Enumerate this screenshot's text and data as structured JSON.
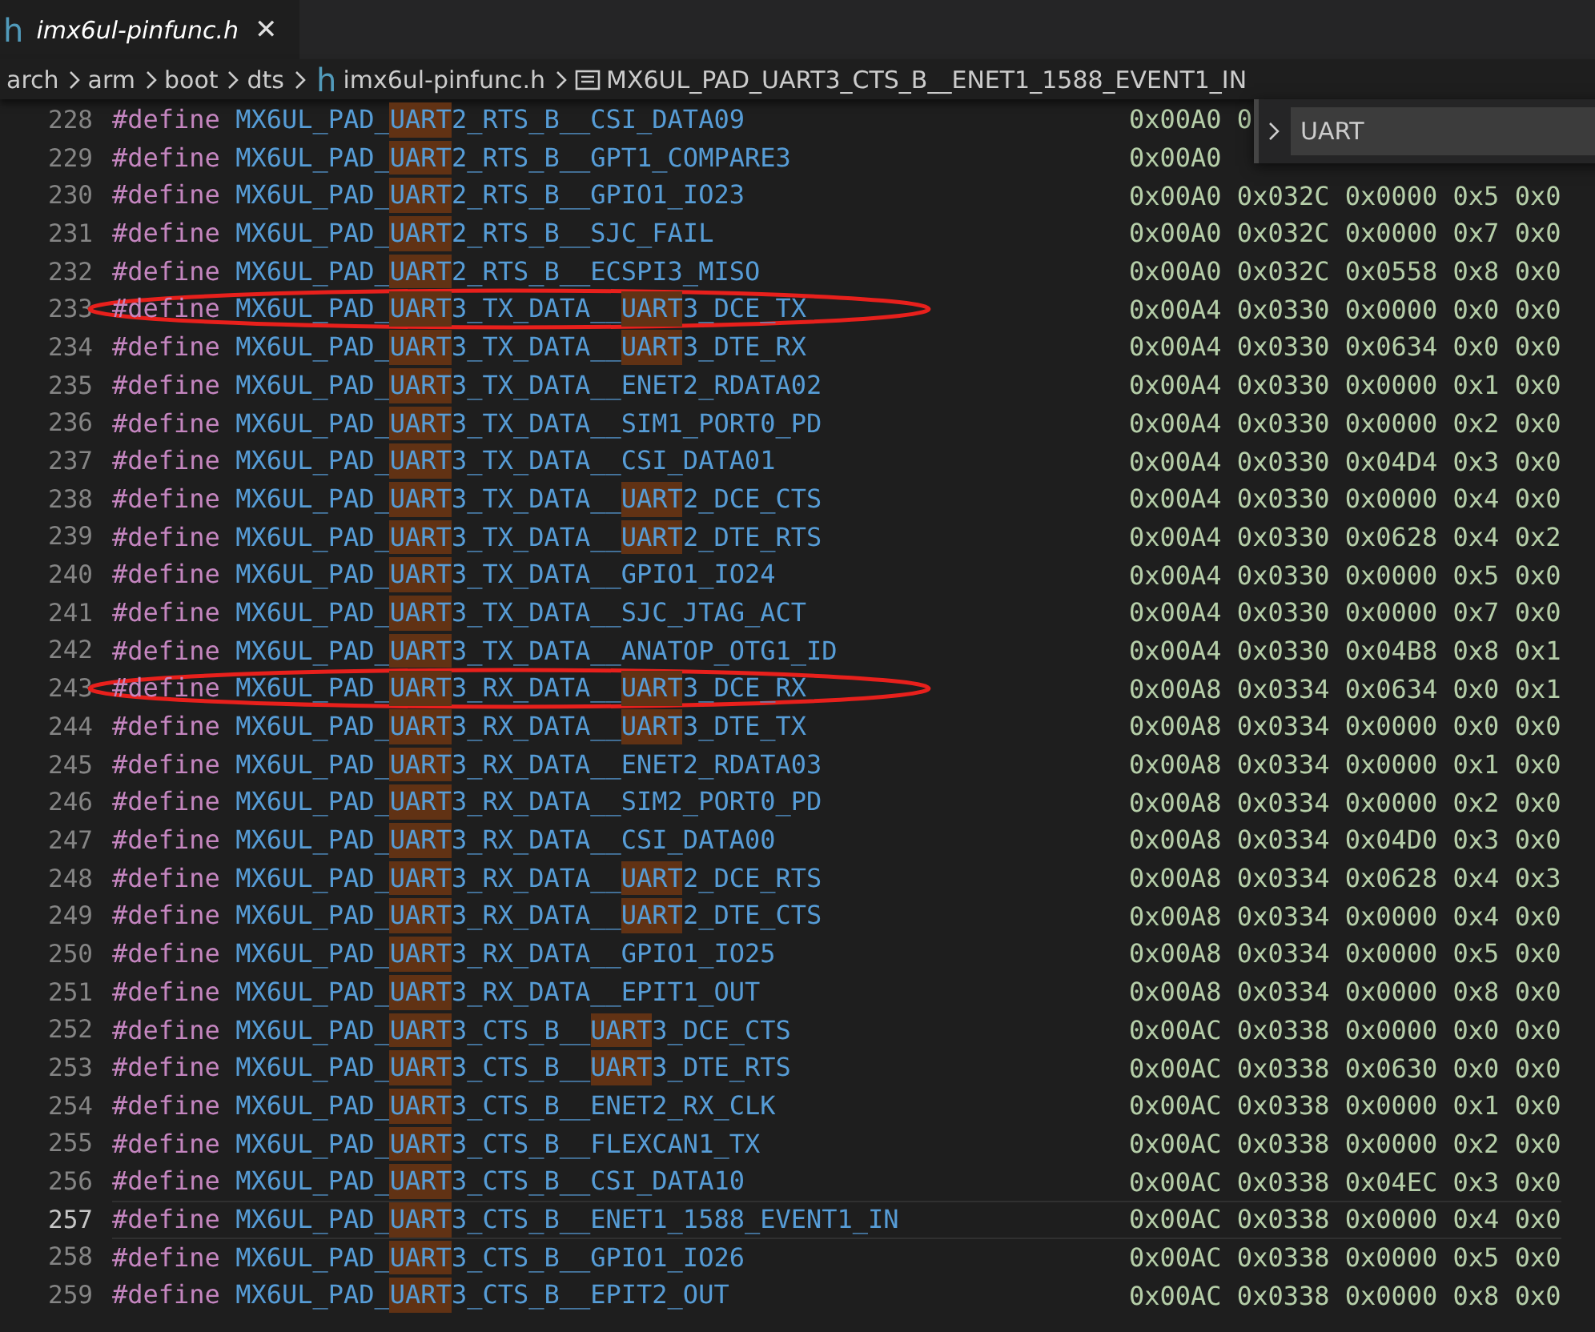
{
  "tab": {
    "icon": "h",
    "title": "imx6ul-pinfunc.h",
    "preview": true,
    "close": "✕"
  },
  "breadcrumbs": [
    {
      "text": "arch",
      "kind": "folder"
    },
    {
      "text": "arm",
      "kind": "folder"
    },
    {
      "text": "boot",
      "kind": "folder"
    },
    {
      "text": "dts",
      "kind": "folder"
    },
    {
      "text": "imx6ul-pinfunc.h",
      "kind": "file",
      "icon": "h"
    },
    {
      "text": "MX6UL_PAD_UART3_CTS_B__ENET1_1588_EVENT1_IN",
      "kind": "symbol"
    }
  ],
  "find_widget": {
    "value": "UART",
    "expanded": false
  },
  "lines": [
    {
      "number": "228",
      "keyword": "#define",
      "name": [
        {
          "text": "MX6UL_PAD_",
          "match": false
        },
        {
          "text": "UART",
          "match": true
        },
        {
          "text": "2_RTS_B__CSI_DATA09",
          "match": false
        }
      ],
      "values": "0x00A0 0",
      "current": false,
      "annotated": false
    },
    {
      "number": "229",
      "keyword": "#define",
      "name": [
        {
          "text": "MX6UL_PAD_",
          "match": false
        },
        {
          "text": "UART",
          "match": true
        },
        {
          "text": "2_RTS_B__GPT1_COMPARE3",
          "match": false
        }
      ],
      "values": "0x00A0",
      "current": false,
      "annotated": false
    },
    {
      "number": "230",
      "keyword": "#define",
      "name": [
        {
          "text": "MX6UL_PAD_",
          "match": false
        },
        {
          "text": "UART",
          "match": true
        },
        {
          "text": "2_RTS_B__GPIO1_IO23",
          "match": false
        }
      ],
      "values": "0x00A0 0x032C 0x0000 0x5 0x0",
      "current": false,
      "annotated": false
    },
    {
      "number": "231",
      "keyword": "#define",
      "name": [
        {
          "text": "MX6UL_PAD_",
          "match": false
        },
        {
          "text": "UART",
          "match": true
        },
        {
          "text": "2_RTS_B__SJC_FAIL",
          "match": false
        }
      ],
      "values": "0x00A0 0x032C 0x0000 0x7 0x0",
      "current": false,
      "annotated": false
    },
    {
      "number": "232",
      "keyword": "#define",
      "name": [
        {
          "text": "MX6UL_PAD_",
          "match": false
        },
        {
          "text": "UART",
          "match": true
        },
        {
          "text": "2_RTS_B__ECSPI3_MISO",
          "match": false
        }
      ],
      "values": "0x00A0 0x032C 0x0558 0x8 0x0",
      "current": false,
      "annotated": false
    },
    {
      "number": "233",
      "keyword": "#define",
      "name": [
        {
          "text": "MX6UL_PAD_",
          "match": false
        },
        {
          "text": "UART",
          "match": true
        },
        {
          "text": "3_TX_DATA__",
          "match": false
        },
        {
          "text": "UART",
          "match": true
        },
        {
          "text": "3_DCE_TX",
          "match": false
        }
      ],
      "values": "0x00A4 0x0330 0x0000 0x0 0x0",
      "current": false,
      "annotated": true
    },
    {
      "number": "234",
      "keyword": "#define",
      "name": [
        {
          "text": "MX6UL_PAD_",
          "match": false
        },
        {
          "text": "UART",
          "match": true
        },
        {
          "text": "3_TX_DATA__",
          "match": false
        },
        {
          "text": "UART",
          "match": true
        },
        {
          "text": "3_DTE_RX",
          "match": false
        }
      ],
      "values": "0x00A4 0x0330 0x0634 0x0 0x0",
      "current": false,
      "annotated": false
    },
    {
      "number": "235",
      "keyword": "#define",
      "name": [
        {
          "text": "MX6UL_PAD_",
          "match": false
        },
        {
          "text": "UART",
          "match": true
        },
        {
          "text": "3_TX_DATA__ENET2_RDATA02",
          "match": false
        }
      ],
      "values": "0x00A4 0x0330 0x0000 0x1 0x0",
      "current": false,
      "annotated": false
    },
    {
      "number": "236",
      "keyword": "#define",
      "name": [
        {
          "text": "MX6UL_PAD_",
          "match": false
        },
        {
          "text": "UART",
          "match": true
        },
        {
          "text": "3_TX_DATA__SIM1_PORT0_PD",
          "match": false
        }
      ],
      "values": "0x00A4 0x0330 0x0000 0x2 0x0",
      "current": false,
      "annotated": false
    },
    {
      "number": "237",
      "keyword": "#define",
      "name": [
        {
          "text": "MX6UL_PAD_",
          "match": false
        },
        {
          "text": "UART",
          "match": true
        },
        {
          "text": "3_TX_DATA__CSI_DATA01",
          "match": false
        }
      ],
      "values": "0x00A4 0x0330 0x04D4 0x3 0x0",
      "current": false,
      "annotated": false
    },
    {
      "number": "238",
      "keyword": "#define",
      "name": [
        {
          "text": "MX6UL_PAD_",
          "match": false
        },
        {
          "text": "UART",
          "match": true
        },
        {
          "text": "3_TX_DATA__",
          "match": false
        },
        {
          "text": "UART",
          "match": true
        },
        {
          "text": "2_DCE_CTS",
          "match": false
        }
      ],
      "values": "0x00A4 0x0330 0x0000 0x4 0x0",
      "current": false,
      "annotated": false
    },
    {
      "number": "239",
      "keyword": "#define",
      "name": [
        {
          "text": "MX6UL_PAD_",
          "match": false
        },
        {
          "text": "UART",
          "match": true
        },
        {
          "text": "3_TX_DATA__",
          "match": false
        },
        {
          "text": "UART",
          "match": true
        },
        {
          "text": "2_DTE_RTS",
          "match": false
        }
      ],
      "values": "0x00A4 0x0330 0x0628 0x4 0x2",
      "current": false,
      "annotated": false
    },
    {
      "number": "240",
      "keyword": "#define",
      "name": [
        {
          "text": "MX6UL_PAD_",
          "match": false
        },
        {
          "text": "UART",
          "match": true
        },
        {
          "text": "3_TX_DATA__GPIO1_IO24",
          "match": false
        }
      ],
      "values": "0x00A4 0x0330 0x0000 0x5 0x0",
      "current": false,
      "annotated": false
    },
    {
      "number": "241",
      "keyword": "#define",
      "name": [
        {
          "text": "MX6UL_PAD_",
          "match": false
        },
        {
          "text": "UART",
          "match": true
        },
        {
          "text": "3_TX_DATA__SJC_JTAG_ACT",
          "match": false
        }
      ],
      "values": "0x00A4 0x0330 0x0000 0x7 0x0",
      "current": false,
      "annotated": false
    },
    {
      "number": "242",
      "keyword": "#define",
      "name": [
        {
          "text": "MX6UL_PAD_",
          "match": false
        },
        {
          "text": "UART",
          "match": true
        },
        {
          "text": "3_TX_DATA__ANATOP_OTG1_ID",
          "match": false
        }
      ],
      "values": "0x00A4 0x0330 0x04B8 0x8 0x1",
      "current": false,
      "annotated": false
    },
    {
      "number": "243",
      "keyword": "#define",
      "name": [
        {
          "text": "MX6UL_PAD_",
          "match": false
        },
        {
          "text": "UART",
          "match": true
        },
        {
          "text": "3_RX_DATA__",
          "match": false
        },
        {
          "text": "UART",
          "match": true
        },
        {
          "text": "3_DCE_RX",
          "match": false
        }
      ],
      "values": "0x00A8 0x0334 0x0634 0x0 0x1",
      "current": false,
      "annotated": true
    },
    {
      "number": "244",
      "keyword": "#define",
      "name": [
        {
          "text": "MX6UL_PAD_",
          "match": false
        },
        {
          "text": "UART",
          "match": true
        },
        {
          "text": "3_RX_DATA__",
          "match": false
        },
        {
          "text": "UART",
          "match": true
        },
        {
          "text": "3_DTE_TX",
          "match": false
        }
      ],
      "values": "0x00A8 0x0334 0x0000 0x0 0x0",
      "current": false,
      "annotated": false
    },
    {
      "number": "245",
      "keyword": "#define",
      "name": [
        {
          "text": "MX6UL_PAD_",
          "match": false
        },
        {
          "text": "UART",
          "match": true
        },
        {
          "text": "3_RX_DATA__ENET2_RDATA03",
          "match": false
        }
      ],
      "values": "0x00A8 0x0334 0x0000 0x1 0x0",
      "current": false,
      "annotated": false
    },
    {
      "number": "246",
      "keyword": "#define",
      "name": [
        {
          "text": "MX6UL_PAD_",
          "match": false
        },
        {
          "text": "UART",
          "match": true
        },
        {
          "text": "3_RX_DATA__SIM2_PORT0_PD",
          "match": false
        }
      ],
      "values": "0x00A8 0x0334 0x0000 0x2 0x0",
      "current": false,
      "annotated": false
    },
    {
      "number": "247",
      "keyword": "#define",
      "name": [
        {
          "text": "MX6UL_PAD_",
          "match": false
        },
        {
          "text": "UART",
          "match": true
        },
        {
          "text": "3_RX_DATA__CSI_DATA00",
          "match": false
        }
      ],
      "values": "0x00A8 0x0334 0x04D0 0x3 0x0",
      "current": false,
      "annotated": false
    },
    {
      "number": "248",
      "keyword": "#define",
      "name": [
        {
          "text": "MX6UL_PAD_",
          "match": false
        },
        {
          "text": "UART",
          "match": true
        },
        {
          "text": "3_RX_DATA__",
          "match": false
        },
        {
          "text": "UART",
          "match": true
        },
        {
          "text": "2_DCE_RTS",
          "match": false
        }
      ],
      "values": "0x00A8 0x0334 0x0628 0x4 0x3",
      "current": false,
      "annotated": false
    },
    {
      "number": "249",
      "keyword": "#define",
      "name": [
        {
          "text": "MX6UL_PAD_",
          "match": false
        },
        {
          "text": "UART",
          "match": true
        },
        {
          "text": "3_RX_DATA__",
          "match": false
        },
        {
          "text": "UART",
          "match": true
        },
        {
          "text": "2_DTE_CTS",
          "match": false
        }
      ],
      "values": "0x00A8 0x0334 0x0000 0x4 0x0",
      "current": false,
      "annotated": false
    },
    {
      "number": "250",
      "keyword": "#define",
      "name": [
        {
          "text": "MX6UL_PAD_",
          "match": false
        },
        {
          "text": "UART",
          "match": true
        },
        {
          "text": "3_RX_DATA__GPIO1_IO25",
          "match": false
        }
      ],
      "values": "0x00A8 0x0334 0x0000 0x5 0x0",
      "current": false,
      "annotated": false
    },
    {
      "number": "251",
      "keyword": "#define",
      "name": [
        {
          "text": "MX6UL_PAD_",
          "match": false
        },
        {
          "text": "UART",
          "match": true
        },
        {
          "text": "3_RX_DATA__EPIT1_OUT",
          "match": false
        }
      ],
      "values": "0x00A8 0x0334 0x0000 0x8 0x0",
      "current": false,
      "annotated": false
    },
    {
      "number": "252",
      "keyword": "#define",
      "name": [
        {
          "text": "MX6UL_PAD_",
          "match": false
        },
        {
          "text": "UART",
          "match": true
        },
        {
          "text": "3_CTS_B__",
          "match": false
        },
        {
          "text": "UART",
          "match": true
        },
        {
          "text": "3_DCE_CTS",
          "match": false
        }
      ],
      "values": "0x00AC 0x0338 0x0000 0x0 0x0",
      "current": false,
      "annotated": false
    },
    {
      "number": "253",
      "keyword": "#define",
      "name": [
        {
          "text": "MX6UL_PAD_",
          "match": false
        },
        {
          "text": "UART",
          "match": true
        },
        {
          "text": "3_CTS_B__",
          "match": false
        },
        {
          "text": "UART",
          "match": true
        },
        {
          "text": "3_DTE_RTS",
          "match": false
        }
      ],
      "values": "0x00AC 0x0338 0x0630 0x0 0x0",
      "current": false,
      "annotated": false
    },
    {
      "number": "254",
      "keyword": "#define",
      "name": [
        {
          "text": "MX6UL_PAD_",
          "match": false
        },
        {
          "text": "UART",
          "match": true
        },
        {
          "text": "3_CTS_B__ENET2_RX_CLK",
          "match": false
        }
      ],
      "values": "0x00AC 0x0338 0x0000 0x1 0x0",
      "current": false,
      "annotated": false
    },
    {
      "number": "255",
      "keyword": "#define",
      "name": [
        {
          "text": "MX6UL_PAD_",
          "match": false
        },
        {
          "text": "UART",
          "match": true
        },
        {
          "text": "3_CTS_B__FLEXCAN1_TX",
          "match": false
        }
      ],
      "values": "0x00AC 0x0338 0x0000 0x2 0x0",
      "current": false,
      "annotated": false
    },
    {
      "number": "256",
      "keyword": "#define",
      "name": [
        {
          "text": "MX6UL_PAD_",
          "match": false
        },
        {
          "text": "UART",
          "match": true
        },
        {
          "text": "3_CTS_B__CSI_DATA10",
          "match": false
        }
      ],
      "values": "0x00AC 0x0338 0x04EC 0x3 0x0",
      "current": false,
      "annotated": false
    },
    {
      "number": "257",
      "keyword": "#define",
      "name": [
        {
          "text": "MX6UL_PAD_",
          "match": false
        },
        {
          "text": "UART",
          "match": true
        },
        {
          "text": "3_CTS_B__ENET1_1588_EVENT1_IN",
          "match": false
        }
      ],
      "values": "0x00AC 0x0338 0x0000 0x4 0x0",
      "current": true,
      "annotated": false
    },
    {
      "number": "258",
      "keyword": "#define",
      "name": [
        {
          "text": "MX6UL_PAD_",
          "match": false
        },
        {
          "text": "UART",
          "match": true
        },
        {
          "text": "3_CTS_B__GPIO1_IO26",
          "match": false
        }
      ],
      "values": "0x00AC 0x0338 0x0000 0x5 0x0",
      "current": false,
      "annotated": false
    },
    {
      "number": "259",
      "keyword": "#define",
      "name": [
        {
          "text": "MX6UL_PAD_",
          "match": false
        },
        {
          "text": "UART",
          "match": true
        },
        {
          "text": "3_CTS_B__EPIT2_OUT",
          "match": false
        }
      ],
      "values": "0x00AC 0x0338 0x0000 0x8 0x0",
      "current": false,
      "annotated": false
    }
  ]
}
